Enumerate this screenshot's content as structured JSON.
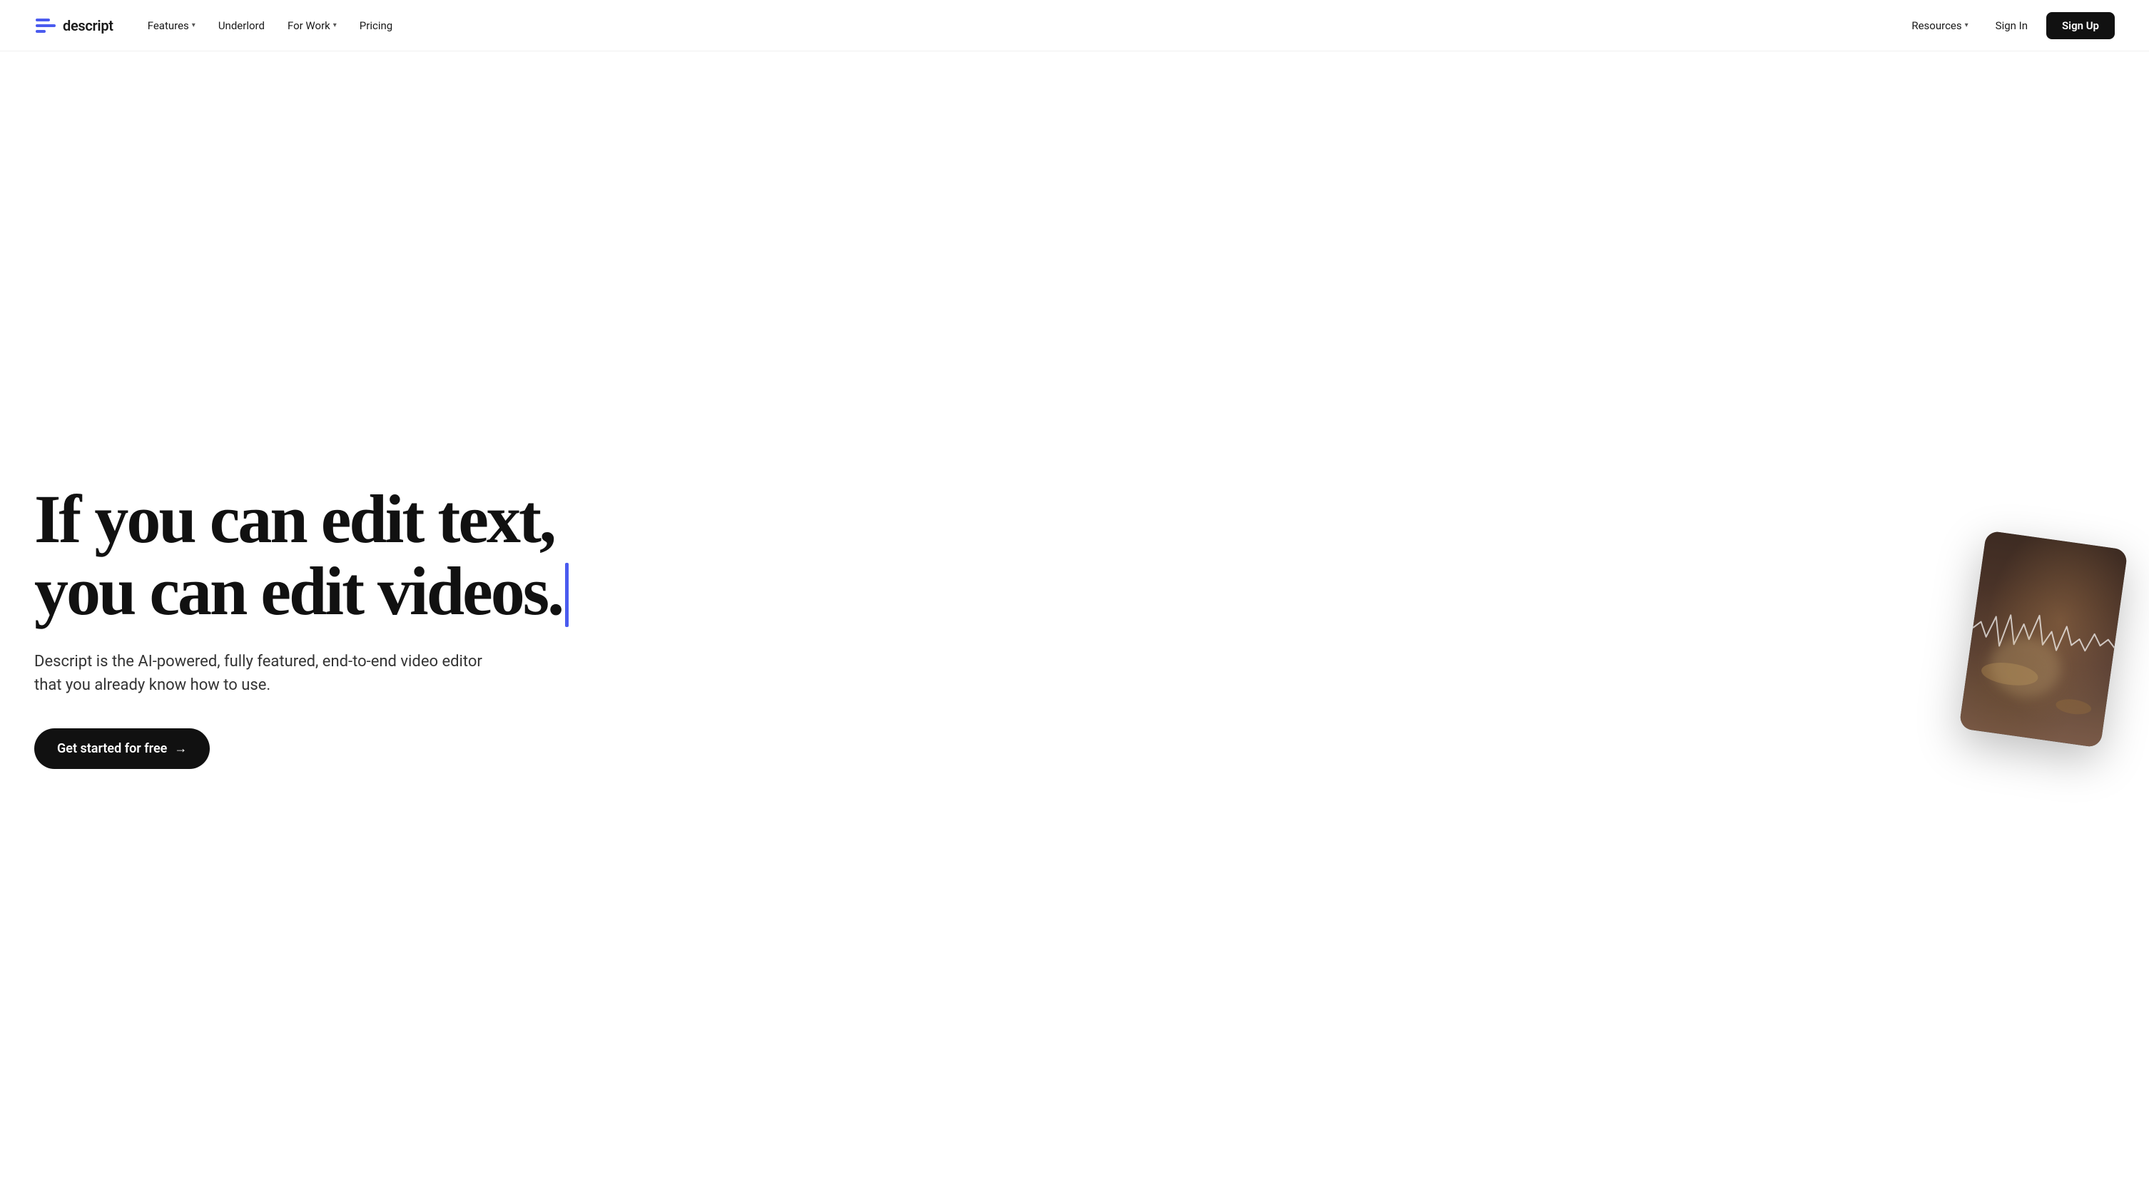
{
  "nav": {
    "logo_text": "descript",
    "links": [
      {
        "label": "Features",
        "has_dropdown": true
      },
      {
        "label": "Underlord",
        "has_dropdown": false
      },
      {
        "label": "For Work",
        "has_dropdown": true
      },
      {
        "label": "Pricing",
        "has_dropdown": false
      }
    ],
    "right_links": [
      {
        "label": "Resources",
        "has_dropdown": true
      },
      {
        "label": "Sign In",
        "has_dropdown": false
      }
    ],
    "signup_label": "Sign Up"
  },
  "hero": {
    "headline_line1": "If you can edit text,",
    "headline_line2": "you can edit videos.",
    "subtext": "Descript is the AI-powered, fully featured, end-to-end video editor that you already know how to use.",
    "cta_label": "Get started for free",
    "cta_arrow": "→",
    "cursor_color": "#4a5bef"
  }
}
